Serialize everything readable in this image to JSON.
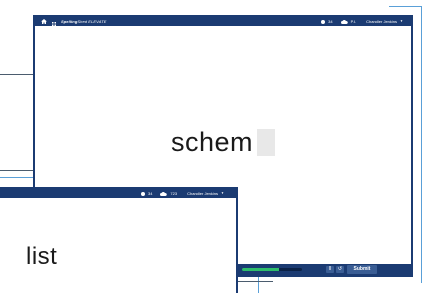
{
  "colors": {
    "nav_bg": "#1b3b72",
    "progress_fill": "#2ebd6b",
    "button_bg": "#3a5d94",
    "cursor_box": "#e8e8e8"
  },
  "main_window": {
    "brand": {
      "prefix": "Spelling",
      "suffix": "Shed ELEVATE"
    },
    "icons": {
      "home": "home-icon",
      "grid": "grid-icon",
      "coin": "coin-icon",
      "cloud": "cloud-icon",
      "caret": "caret-down-icon"
    },
    "coins": "34",
    "cloud_score": "P.I.",
    "user_name": "Chandler Jenkins",
    "current_word": "schem",
    "progress": 0.62,
    "pause_label": "II",
    "reset_label": "↺",
    "submit_label": "Submit"
  },
  "back_window": {
    "coins": "34",
    "cloud_score": "723",
    "user_name": "Chandler Jenkins",
    "current_word": "list"
  }
}
